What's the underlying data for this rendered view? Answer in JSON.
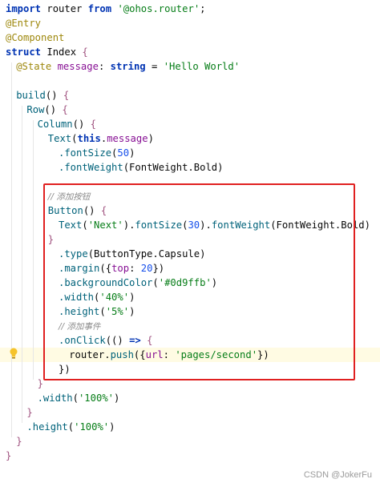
{
  "editor": {
    "lines": [
      {
        "indent": 0,
        "tokens": [
          {
            "t": "import ",
            "c": "kw"
          },
          {
            "t": "router ",
            "c": "plain"
          },
          {
            "t": "from ",
            "c": "kw"
          },
          {
            "t": "'@ohos.router'",
            "c": "str"
          },
          {
            "t": ";",
            "c": "plain"
          }
        ]
      },
      {
        "indent": 0,
        "tokens": [
          {
            "t": "@Entry",
            "c": "anno"
          }
        ]
      },
      {
        "indent": 0,
        "tokens": [
          {
            "t": "@Component",
            "c": "anno"
          }
        ]
      },
      {
        "indent": 0,
        "tokens": [
          {
            "t": "struct ",
            "c": "kw"
          },
          {
            "t": "Index ",
            "c": "plain"
          },
          {
            "t": "{",
            "c": "brace"
          }
        ]
      },
      {
        "indent": 1,
        "tokens": [
          {
            "t": "@State ",
            "c": "anno"
          },
          {
            "t": "message",
            "c": "prop"
          },
          {
            "t": ": ",
            "c": "plain"
          },
          {
            "t": "string ",
            "c": "kw"
          },
          {
            "t": "= ",
            "c": "plain"
          },
          {
            "t": "'Hello World'",
            "c": "str"
          }
        ]
      },
      {
        "indent": 0,
        "tokens": []
      },
      {
        "indent": 1,
        "tokens": [
          {
            "t": "build",
            "c": "comp"
          },
          {
            "t": "() ",
            "c": "plain"
          },
          {
            "t": "{",
            "c": "brace"
          }
        ]
      },
      {
        "indent": 2,
        "tokens": [
          {
            "t": "Row",
            "c": "comp"
          },
          {
            "t": "() ",
            "c": "plain"
          },
          {
            "t": "{",
            "c": "brace"
          }
        ]
      },
      {
        "indent": 3,
        "tokens": [
          {
            "t": "Column",
            "c": "comp"
          },
          {
            "t": "() ",
            "c": "plain"
          },
          {
            "t": "{",
            "c": "brace"
          }
        ]
      },
      {
        "indent": 4,
        "tokens": [
          {
            "t": "Text",
            "c": "comp"
          },
          {
            "t": "(",
            "c": "plain"
          },
          {
            "t": "this",
            "c": "kw"
          },
          {
            "t": ".",
            "c": "plain"
          },
          {
            "t": "message",
            "c": "prop"
          },
          {
            "t": ")",
            "c": "plain"
          }
        ]
      },
      {
        "indent": 5,
        "tokens": [
          {
            "t": ".fontSize",
            "c": "comp"
          },
          {
            "t": "(",
            "c": "plain"
          },
          {
            "t": "50",
            "c": "num"
          },
          {
            "t": ")",
            "c": "plain"
          }
        ]
      },
      {
        "indent": 5,
        "tokens": [
          {
            "t": ".fontWeight",
            "c": "comp"
          },
          {
            "t": "(FontWeight.Bold)",
            "c": "plain"
          }
        ]
      },
      {
        "indent": 0,
        "tokens": []
      },
      {
        "indent": 4,
        "tokens": [
          {
            "t": "// 添加按钮",
            "c": "comment"
          }
        ]
      },
      {
        "indent": 4,
        "tokens": [
          {
            "t": "Button",
            "c": "comp"
          },
          {
            "t": "() ",
            "c": "plain"
          },
          {
            "t": "{",
            "c": "brace"
          }
        ]
      },
      {
        "indent": 5,
        "tokens": [
          {
            "t": "Text",
            "c": "comp"
          },
          {
            "t": "(",
            "c": "plain"
          },
          {
            "t": "'Next'",
            "c": "str"
          },
          {
            "t": ").",
            "c": "plain"
          },
          {
            "t": "fontSize",
            "c": "comp"
          },
          {
            "t": "(",
            "c": "plain"
          },
          {
            "t": "30",
            "c": "num"
          },
          {
            "t": ").",
            "c": "plain"
          },
          {
            "t": "fontWeight",
            "c": "comp"
          },
          {
            "t": "(FontWeight.Bold)",
            "c": "plain"
          }
        ]
      },
      {
        "indent": 4,
        "tokens": [
          {
            "t": "}",
            "c": "brace"
          }
        ]
      },
      {
        "indent": 5,
        "tokens": [
          {
            "t": ".type",
            "c": "comp"
          },
          {
            "t": "(ButtonType.Capsule)",
            "c": "plain"
          }
        ]
      },
      {
        "indent": 5,
        "tokens": [
          {
            "t": ".margin",
            "c": "comp"
          },
          {
            "t": "({",
            "c": "plain"
          },
          {
            "t": "top",
            "c": "prop"
          },
          {
            "t": ": ",
            "c": "plain"
          },
          {
            "t": "20",
            "c": "num"
          },
          {
            "t": "})",
            "c": "plain"
          }
        ]
      },
      {
        "indent": 5,
        "tokens": [
          {
            "t": ".backgroundColor",
            "c": "comp"
          },
          {
            "t": "(",
            "c": "plain"
          },
          {
            "t": "'#0d9ffb'",
            "c": "str"
          },
          {
            "t": ")",
            "c": "plain"
          }
        ]
      },
      {
        "indent": 5,
        "tokens": [
          {
            "t": ".width",
            "c": "comp"
          },
          {
            "t": "(",
            "c": "plain"
          },
          {
            "t": "'40%'",
            "c": "str"
          },
          {
            "t": ")",
            "c": "plain"
          }
        ]
      },
      {
        "indent": 5,
        "tokens": [
          {
            "t": ".height",
            "c": "comp"
          },
          {
            "t": "(",
            "c": "plain"
          },
          {
            "t": "'5%'",
            "c": "str"
          },
          {
            "t": ")",
            "c": "plain"
          }
        ]
      },
      {
        "indent": 5,
        "tokens": [
          {
            "t": "// 添加事件",
            "c": "comment"
          }
        ]
      },
      {
        "indent": 5,
        "tokens": [
          {
            "t": ".onClick",
            "c": "comp"
          },
          {
            "t": "(() ",
            "c": "plain"
          },
          {
            "t": "=> ",
            "c": "kw"
          },
          {
            "t": "{",
            "c": "brace"
          }
        ]
      },
      {
        "indent": 6,
        "highlighted": true,
        "tokens": [
          {
            "t": "router.",
            "c": "plain"
          },
          {
            "t": "push",
            "c": "comp"
          },
          {
            "t": "({",
            "c": "plain"
          },
          {
            "t": "url",
            "c": "prop"
          },
          {
            "t": ": ",
            "c": "plain"
          },
          {
            "t": "'pages/second'",
            "c": "str"
          },
          {
            "t": "})",
            "c": "plain"
          }
        ]
      },
      {
        "indent": 5,
        "tokens": [
          {
            "t": "})",
            "c": "plain"
          }
        ]
      },
      {
        "indent": 3,
        "tokens": [
          {
            "t": "}",
            "c": "brace"
          }
        ]
      },
      {
        "indent": 3,
        "tokens": [
          {
            "t": ".width",
            "c": "comp"
          },
          {
            "t": "(",
            "c": "plain"
          },
          {
            "t": "'100%'",
            "c": "str"
          },
          {
            "t": ")",
            "c": "plain"
          }
        ]
      },
      {
        "indent": 2,
        "tokens": [
          {
            "t": "}",
            "c": "brace"
          }
        ]
      },
      {
        "indent": 2,
        "tokens": [
          {
            "t": ".height",
            "c": "comp"
          },
          {
            "t": "(",
            "c": "plain"
          },
          {
            "t": "'100%'",
            "c": "str"
          },
          {
            "t": ")",
            "c": "plain"
          }
        ]
      },
      {
        "indent": 1,
        "tokens": [
          {
            "t": "}",
            "c": "brace"
          }
        ]
      },
      {
        "indent": 0,
        "tokens": [
          {
            "t": "}",
            "c": "brace"
          }
        ]
      }
    ]
  },
  "annotation": {
    "highlight_color": "#e02020",
    "bulb_icon": "lightbulb-icon"
  },
  "watermark": {
    "text": "CSDN @JokerFu"
  }
}
